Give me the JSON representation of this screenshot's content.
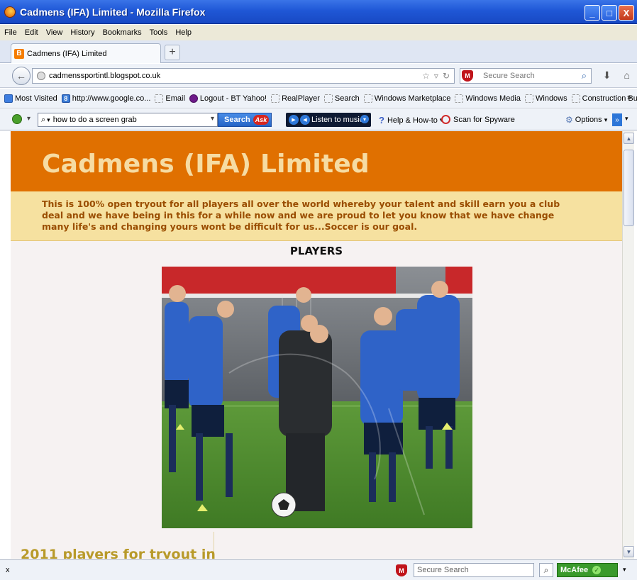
{
  "window": {
    "title": "Cadmens (IFA) Limited - Mozilla Firefox",
    "controls": [
      "_",
      "□",
      "X"
    ]
  },
  "menu": [
    "File",
    "Edit",
    "View",
    "History",
    "Bookmarks",
    "Tools",
    "Help"
  ],
  "tab": {
    "label": "Cadmens (IFA) Limited",
    "favicon": "B",
    "new_tab": "+"
  },
  "nav": {
    "url": "cadmenssportintl.blogspot.co.uk",
    "search_placeholder": "Secure Search",
    "back_icon": "←"
  },
  "bookmarks": [
    {
      "label": "Most Visited",
      "icon": "blue"
    },
    {
      "label": "http://www.google.co...",
      "icon": "g"
    },
    {
      "label": "Email",
      "icon": "blank"
    },
    {
      "label": "Logout - BT Yahoo!",
      "icon": "yahoo"
    },
    {
      "label": "RealPlayer",
      "icon": "blank"
    },
    {
      "label": "Search",
      "icon": "blank"
    },
    {
      "label": "Windows Marketplace",
      "icon": "blank"
    },
    {
      "label": "Windows Media",
      "icon": "blank"
    },
    {
      "label": "Windows",
      "icon": "blank"
    },
    {
      "label": "Construction Business...",
      "icon": "blank"
    }
  ],
  "bookmarks_more": "»",
  "ask_toolbar": {
    "query": "how to do a screen grab",
    "search_label": "Search",
    "ask_label": "Ask",
    "music_label": "Listen to music",
    "help_label": "Help & How-to",
    "spyware_label": "Scan for Spyware",
    "options_label": "Options"
  },
  "page": {
    "site_title": "Cadmens (IFA) Limited",
    "description": "This is 100% open tryout for all players all over the world whereby your talent and skill earn you a club deal and we have being in this for a while now and we are proud to let you know that we have change many life's and changing yours wont be difficult for us...Soccer is our goal.",
    "section_title": "PLAYERS",
    "sub_heading": "2011 players for tryout in"
  },
  "status": {
    "close_label": "x",
    "search_placeholder": "Secure Search",
    "mcafee_label": "McAfee"
  },
  "colors": {
    "banner": "#e07000",
    "banner_title": "#f6dca3",
    "description_bg": "#f6e1a0",
    "description_text": "#9a4d00",
    "titlebar": "#1f57d6"
  }
}
